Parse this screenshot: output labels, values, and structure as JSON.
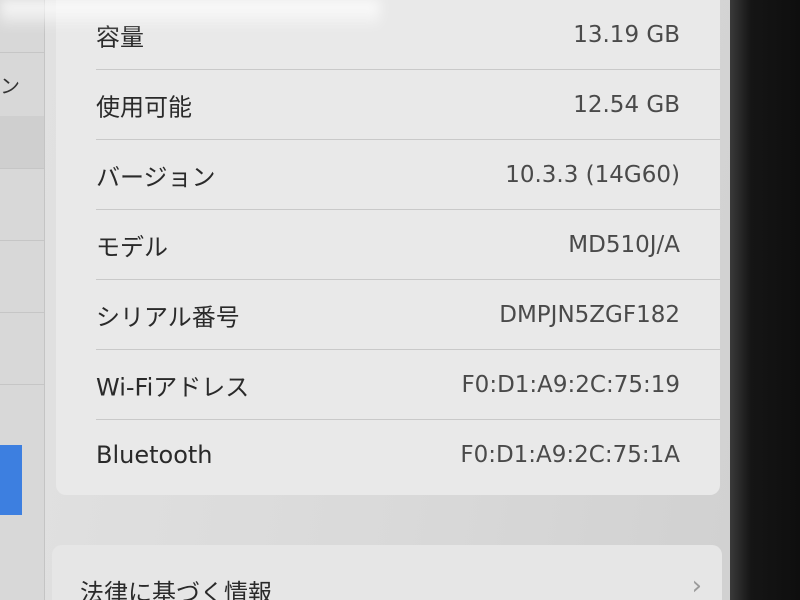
{
  "about": {
    "rows": [
      {
        "label": "容量",
        "value": "13.19 GB"
      },
      {
        "label": "使用可能",
        "value": "12.54 GB"
      },
      {
        "label": "バージョン",
        "value": "10.3.3 (14G60)"
      },
      {
        "label": "モデル",
        "value": "MD510J/A"
      },
      {
        "label": "シリアル番号",
        "value": "DMPJN5ZGF182"
      },
      {
        "label": "Wi-Fiアドレス",
        "value": "F0:D1:A9:2C:75:19"
      },
      {
        "label": "Bluetooth",
        "value": "F0:D1:A9:2C:75:1A"
      }
    ]
  },
  "legal": {
    "label": "法律に基づく情報"
  },
  "sidebar": {
    "partial_label": "ン"
  },
  "colors": {
    "selection": "#3d7fe0",
    "group_bg": "#e9e9e9",
    "bezel": "#111111"
  },
  "icons": {
    "disclosure": "chevron-right-icon"
  }
}
